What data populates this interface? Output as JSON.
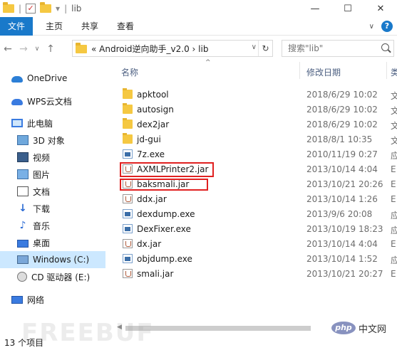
{
  "window": {
    "title": "lib",
    "minimize": "—",
    "maximize": "☐",
    "close": "✕"
  },
  "ribbon": {
    "file": "文件",
    "tabs": [
      "主页",
      "共享",
      "查看"
    ],
    "help": "?"
  },
  "nav": {
    "back": "←",
    "forward": "→",
    "recent": "∨",
    "up": "↑",
    "address": "« Android逆向助手_v2.0 › lib",
    "refresh": "↻",
    "search_placeholder": "搜索\"lib\""
  },
  "sidebar": {
    "items": [
      {
        "label": "OneDrive",
        "icon": "cloud-icon"
      },
      {
        "label": "WPS云文档",
        "icon": "wps-cloud-icon"
      },
      {
        "label": "此电脑",
        "icon": "computer-icon"
      },
      {
        "label": "3D 对象",
        "icon": "3d-objects-icon"
      },
      {
        "label": "视频",
        "icon": "video-icon"
      },
      {
        "label": "图片",
        "icon": "picture-icon"
      },
      {
        "label": "文档",
        "icon": "document-icon"
      },
      {
        "label": "下载",
        "icon": "download-icon"
      },
      {
        "label": "音乐",
        "icon": "music-icon"
      },
      {
        "label": "桌面",
        "icon": "desktop-icon"
      },
      {
        "label": "Windows (C:)",
        "icon": "drive-icon"
      },
      {
        "label": "CD 驱动器 (E:)",
        "icon": "cd-drive-icon"
      },
      {
        "label": "网络",
        "icon": "network-icon"
      }
    ]
  },
  "columns": {
    "name": "名称",
    "date": "修改日期",
    "type": "类"
  },
  "files": [
    {
      "name": "apktool",
      "date": "2018/6/29 10:02",
      "kind": "folder"
    },
    {
      "name": "autosign",
      "date": "2018/6/29 10:02",
      "kind": "folder"
    },
    {
      "name": "dex2jar",
      "date": "2018/6/29 10:02",
      "kind": "folder"
    },
    {
      "name": "jd-gui",
      "date": "2018/8/1 10:35",
      "kind": "folder"
    },
    {
      "name": "7z.exe",
      "date": "2010/11/19 0:27",
      "kind": "exe"
    },
    {
      "name": "AXMLPrinter2.jar",
      "date": "2013/10/14 4:04",
      "kind": "jar"
    },
    {
      "name": "baksmali.jar",
      "date": "2013/10/21 20:26",
      "kind": "jar"
    },
    {
      "name": "ddx.jar",
      "date": "2013/10/14 1:26",
      "kind": "jar"
    },
    {
      "name": "dexdump.exe",
      "date": "2013/9/6 20:08",
      "kind": "exe"
    },
    {
      "name": "DexFixer.exe",
      "date": "2013/10/19 18:23",
      "kind": "exe"
    },
    {
      "name": "dx.jar",
      "date": "2013/10/14 4:04",
      "kind": "jar"
    },
    {
      "name": "objdump.exe",
      "date": "2013/10/14 1:52",
      "kind": "exe"
    },
    {
      "name": "smali.jar",
      "date": "2013/10/21 20:27",
      "kind": "jar"
    }
  ],
  "status": {
    "count": "13 个项目"
  },
  "watermark": "FREEBUF",
  "badge": {
    "php": "php",
    "site": "中文网"
  }
}
